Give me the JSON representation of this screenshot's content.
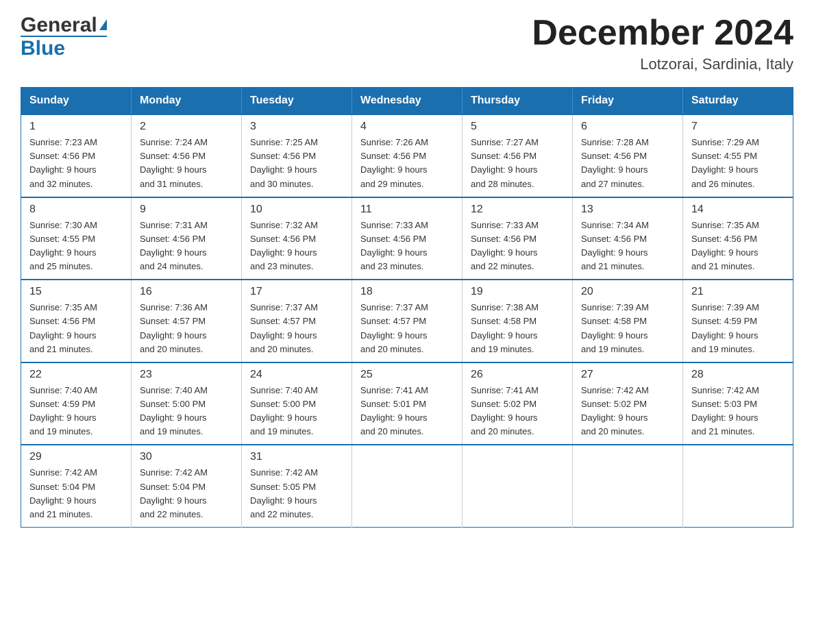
{
  "header": {
    "logo_general": "General",
    "logo_blue": "Blue",
    "month_title": "December 2024",
    "location": "Lotzorai, Sardinia, Italy"
  },
  "days_of_week": [
    "Sunday",
    "Monday",
    "Tuesday",
    "Wednesday",
    "Thursday",
    "Friday",
    "Saturday"
  ],
  "weeks": [
    [
      {
        "day": "1",
        "sunrise": "7:23 AM",
        "sunset": "4:56 PM",
        "daylight": "9 hours and 32 minutes."
      },
      {
        "day": "2",
        "sunrise": "7:24 AM",
        "sunset": "4:56 PM",
        "daylight": "9 hours and 31 minutes."
      },
      {
        "day": "3",
        "sunrise": "7:25 AM",
        "sunset": "4:56 PM",
        "daylight": "9 hours and 30 minutes."
      },
      {
        "day": "4",
        "sunrise": "7:26 AM",
        "sunset": "4:56 PM",
        "daylight": "9 hours and 29 minutes."
      },
      {
        "day": "5",
        "sunrise": "7:27 AM",
        "sunset": "4:56 PM",
        "daylight": "9 hours and 28 minutes."
      },
      {
        "day": "6",
        "sunrise": "7:28 AM",
        "sunset": "4:56 PM",
        "daylight": "9 hours and 27 minutes."
      },
      {
        "day": "7",
        "sunrise": "7:29 AM",
        "sunset": "4:55 PM",
        "daylight": "9 hours and 26 minutes."
      }
    ],
    [
      {
        "day": "8",
        "sunrise": "7:30 AM",
        "sunset": "4:55 PM",
        "daylight": "9 hours and 25 minutes."
      },
      {
        "day": "9",
        "sunrise": "7:31 AM",
        "sunset": "4:56 PM",
        "daylight": "9 hours and 24 minutes."
      },
      {
        "day": "10",
        "sunrise": "7:32 AM",
        "sunset": "4:56 PM",
        "daylight": "9 hours and 23 minutes."
      },
      {
        "day": "11",
        "sunrise": "7:33 AM",
        "sunset": "4:56 PM",
        "daylight": "9 hours and 23 minutes."
      },
      {
        "day": "12",
        "sunrise": "7:33 AM",
        "sunset": "4:56 PM",
        "daylight": "9 hours and 22 minutes."
      },
      {
        "day": "13",
        "sunrise": "7:34 AM",
        "sunset": "4:56 PM",
        "daylight": "9 hours and 21 minutes."
      },
      {
        "day": "14",
        "sunrise": "7:35 AM",
        "sunset": "4:56 PM",
        "daylight": "9 hours and 21 minutes."
      }
    ],
    [
      {
        "day": "15",
        "sunrise": "7:35 AM",
        "sunset": "4:56 PM",
        "daylight": "9 hours and 21 minutes."
      },
      {
        "day": "16",
        "sunrise": "7:36 AM",
        "sunset": "4:57 PM",
        "daylight": "9 hours and 20 minutes."
      },
      {
        "day": "17",
        "sunrise": "7:37 AM",
        "sunset": "4:57 PM",
        "daylight": "9 hours and 20 minutes."
      },
      {
        "day": "18",
        "sunrise": "7:37 AM",
        "sunset": "4:57 PM",
        "daylight": "9 hours and 20 minutes."
      },
      {
        "day": "19",
        "sunrise": "7:38 AM",
        "sunset": "4:58 PM",
        "daylight": "9 hours and 19 minutes."
      },
      {
        "day": "20",
        "sunrise": "7:39 AM",
        "sunset": "4:58 PM",
        "daylight": "9 hours and 19 minutes."
      },
      {
        "day": "21",
        "sunrise": "7:39 AM",
        "sunset": "4:59 PM",
        "daylight": "9 hours and 19 minutes."
      }
    ],
    [
      {
        "day": "22",
        "sunrise": "7:40 AM",
        "sunset": "4:59 PM",
        "daylight": "9 hours and 19 minutes."
      },
      {
        "day": "23",
        "sunrise": "7:40 AM",
        "sunset": "5:00 PM",
        "daylight": "9 hours and 19 minutes."
      },
      {
        "day": "24",
        "sunrise": "7:40 AM",
        "sunset": "5:00 PM",
        "daylight": "9 hours and 19 minutes."
      },
      {
        "day": "25",
        "sunrise": "7:41 AM",
        "sunset": "5:01 PM",
        "daylight": "9 hours and 20 minutes."
      },
      {
        "day": "26",
        "sunrise": "7:41 AM",
        "sunset": "5:02 PM",
        "daylight": "9 hours and 20 minutes."
      },
      {
        "day": "27",
        "sunrise": "7:42 AM",
        "sunset": "5:02 PM",
        "daylight": "9 hours and 20 minutes."
      },
      {
        "day": "28",
        "sunrise": "7:42 AM",
        "sunset": "5:03 PM",
        "daylight": "9 hours and 21 minutes."
      }
    ],
    [
      {
        "day": "29",
        "sunrise": "7:42 AM",
        "sunset": "5:04 PM",
        "daylight": "9 hours and 21 minutes."
      },
      {
        "day": "30",
        "sunrise": "7:42 AM",
        "sunset": "5:04 PM",
        "daylight": "9 hours and 22 minutes."
      },
      {
        "day": "31",
        "sunrise": "7:42 AM",
        "sunset": "5:05 PM",
        "daylight": "9 hours and 22 minutes."
      },
      null,
      null,
      null,
      null
    ]
  ],
  "labels": {
    "sunrise": "Sunrise:",
    "sunset": "Sunset:",
    "daylight": "Daylight:"
  }
}
